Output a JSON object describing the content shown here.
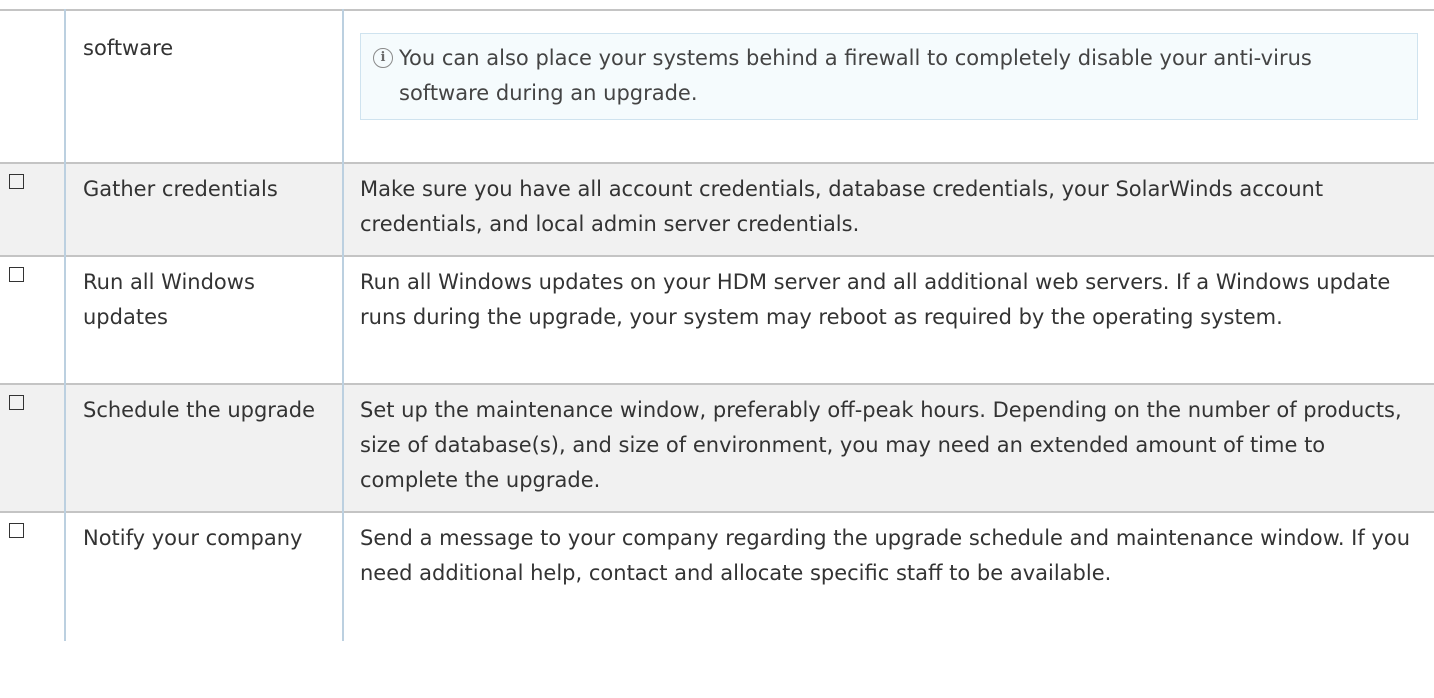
{
  "rows": [
    {
      "task": "software",
      "note_icon": "info-icon",
      "note": "You can also place your systems behind a firewall to completely disable your anti-virus software during an upgrade."
    },
    {
      "task": "Gather credentials",
      "desc": "Make sure you have all account credentials, database credentials, your SolarWinds account credentials, and local admin server credentials.",
      "checked": false
    },
    {
      "task": "Run all Windows updates",
      "desc": "Run all Windows updates on your HDM server and all additional web servers. If a Windows update runs during the upgrade, your system may reboot as required by the operating system.",
      "checked": false
    },
    {
      "task": "Schedule the upgrade",
      "desc": "Set up the maintenance window, preferably off-peak hours. Depending on the number of products, size of database(s), and size of environment, you may need an extended amount of time to complete the upgrade.",
      "checked": false
    },
    {
      "task": "Notify your company",
      "desc": "Send a message to your company regarding the upgrade schedule and maintenance window. If you need additional help, contact and allocate specific staff to be available.",
      "checked": false
    }
  ],
  "colors": {
    "row_shade": "#f1f1f1",
    "column_border": "#bcd0e0",
    "row_border": "#c4c4c4",
    "note_background": "#f5fbfd",
    "note_border": "#cfe3ef"
  }
}
